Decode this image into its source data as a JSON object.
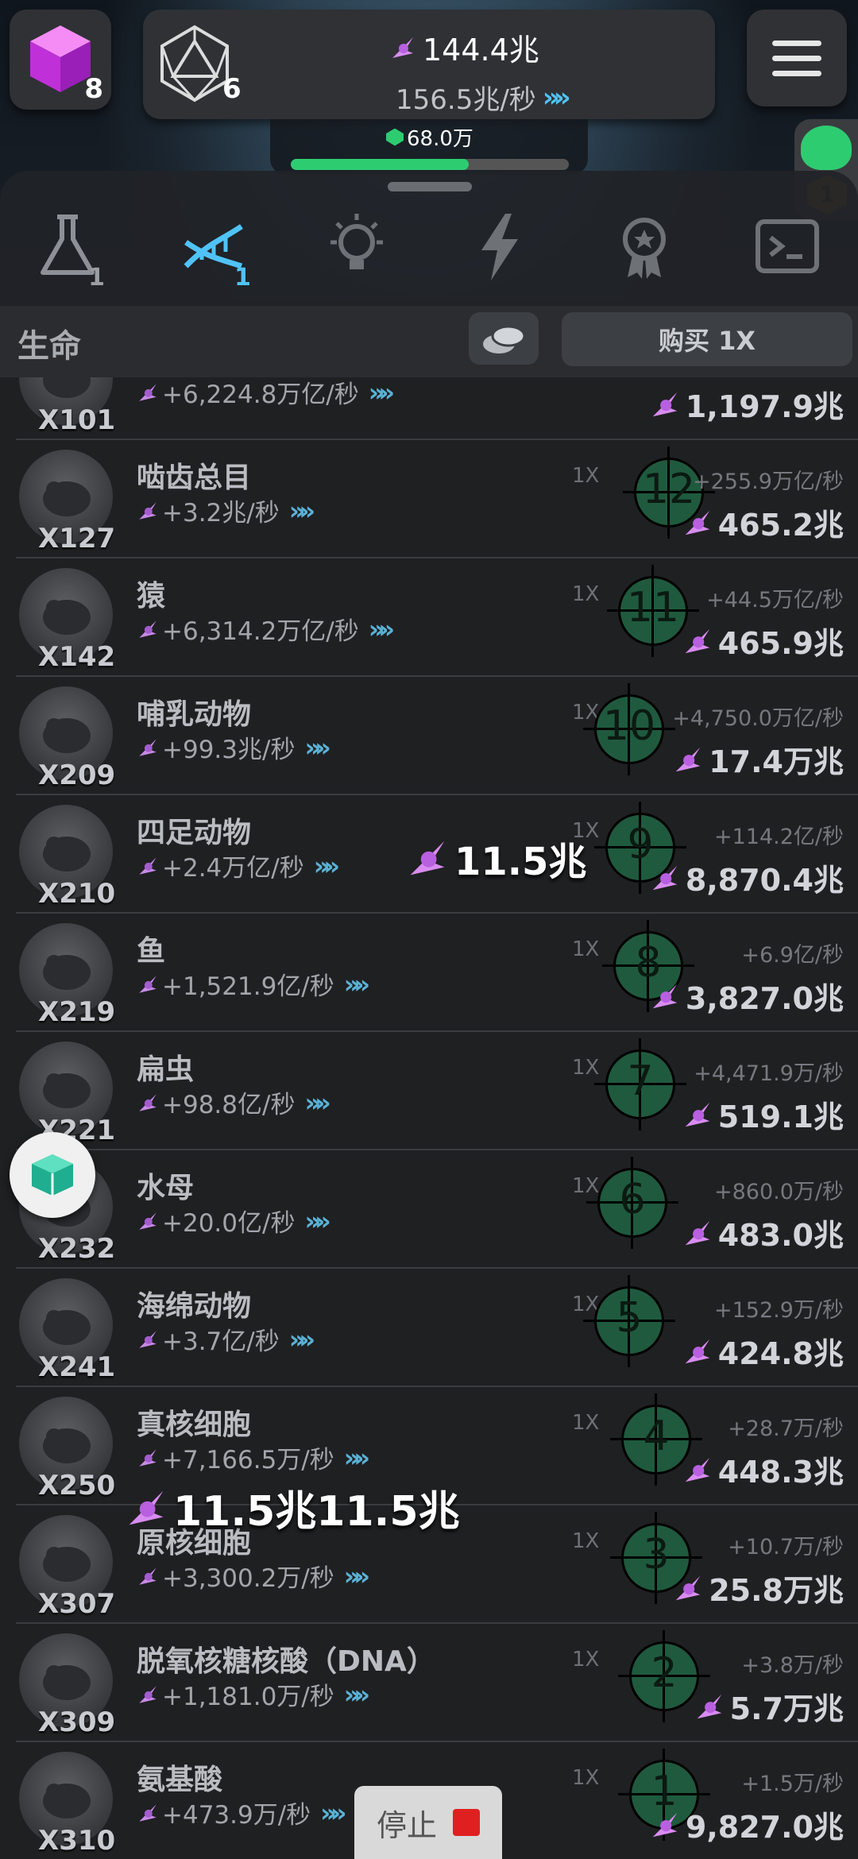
{
  "header": {
    "cube_count": "8",
    "d20_count": "6",
    "currency_total": "144.4兆",
    "currency_rate": "156.5兆/秒",
    "xp_label": "68.0万",
    "xp_progress_percent": 64,
    "side_badge_level": "1"
  },
  "tabs": [
    {
      "name": "flask",
      "count": "1",
      "active": false
    },
    {
      "name": "dna",
      "count": "1",
      "active": true
    },
    {
      "name": "lightbulb",
      "count": "",
      "active": false
    },
    {
      "name": "lightning",
      "count": "",
      "active": false
    },
    {
      "name": "medal",
      "count": "",
      "active": false
    },
    {
      "name": "terminal",
      "count": "",
      "active": false
    }
  ],
  "section": {
    "title": "生命",
    "buy_label": "购买 1X"
  },
  "rows": [
    {
      "mult": "X101",
      "name": "",
      "rate": "+6,224.8万亿/秒",
      "level": "",
      "inc": "",
      "price": "1,197.9兆"
    },
    {
      "mult": "X127",
      "name": "啮齿总目",
      "rate": "+3.2兆/秒",
      "level": "12",
      "inc": "+255.9万亿/秒",
      "price": "465.2兆"
    },
    {
      "mult": "X142",
      "name": "猿",
      "rate": "+6,314.2万亿/秒",
      "level": "11",
      "inc": "+44.5万亿/秒",
      "price": "465.9兆"
    },
    {
      "mult": "X209",
      "name": "哺乳动物",
      "rate": "+99.3兆/秒",
      "level": "10",
      "inc": "+4,750.0万亿/秒",
      "price": "17.4万兆"
    },
    {
      "mult": "X210",
      "name": "四足动物",
      "rate": "+2.4万亿/秒",
      "level": "9",
      "inc": "+114.2亿/秒",
      "price": "8,870.4兆"
    },
    {
      "mult": "X219",
      "name": "鱼",
      "rate": "+1,521.9亿/秒",
      "level": "8",
      "inc": "+6.9亿/秒",
      "price": "3,827.0兆"
    },
    {
      "mult": "X221",
      "name": "扁虫",
      "rate": "+98.8亿/秒",
      "level": "7",
      "inc": "+4,471.9万/秒",
      "price": "519.1兆"
    },
    {
      "mult": "X232",
      "name": "水母",
      "rate": "+20.0亿/秒",
      "level": "6",
      "inc": "+860.0万/秒",
      "price": "483.0兆"
    },
    {
      "mult": "X241",
      "name": "海绵动物",
      "rate": "+3.7亿/秒",
      "level": "5",
      "inc": "+152.9万/秒",
      "price": "424.8兆"
    },
    {
      "mult": "X250",
      "name": "真核细胞",
      "rate": "+7,166.5万/秒",
      "level": "4",
      "inc": "+28.7万/秒",
      "price": "448.3兆"
    },
    {
      "mult": "X307",
      "name": "原核细胞",
      "rate": "+3,300.2万/秒",
      "level": "3",
      "inc": "+10.7万/秒",
      "price": "25.8万兆"
    },
    {
      "mult": "X309",
      "name": "脱氧核糖核酸（DNA）",
      "rate": "+1,181.0万/秒",
      "level": "2",
      "inc": "+3.8万/秒",
      "price": "5.7万兆"
    },
    {
      "mult": "X310",
      "name": "氨基酸",
      "rate": "+473.9万/秒",
      "level": "1",
      "inc": "+1.5万/秒",
      "price": "9,827.0兆"
    }
  ],
  "onex_label": "1X",
  "popups": {
    "mid": "11.5兆",
    "low": "11.5兆11.5兆"
  },
  "stop_button": {
    "label": "停止"
  },
  "colors": {
    "accent": "#4fc3f7",
    "progress": "#2ecc71",
    "target": "#1f5a3e",
    "stop": "#e02020"
  }
}
